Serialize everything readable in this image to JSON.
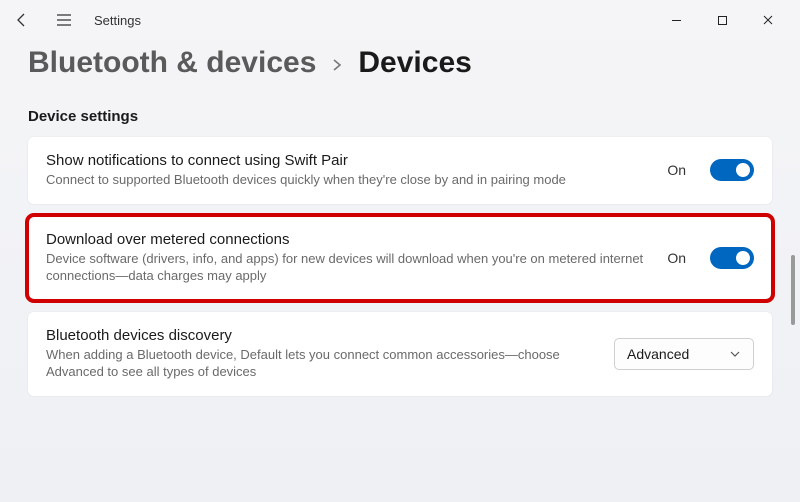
{
  "app": {
    "title": "Settings"
  },
  "breadcrumb": {
    "parent": "Bluetooth & devices",
    "current": "Devices"
  },
  "section": {
    "title": "Device settings"
  },
  "items": [
    {
      "title": "Show notifications to connect using Swift Pair",
      "desc": "Connect to supported Bluetooth devices quickly when they're close by and in pairing mode",
      "status": "On"
    },
    {
      "title": "Download over metered connections",
      "desc": "Device software (drivers, info, and apps) for new devices will download when you're on metered internet connections—data charges may apply",
      "status": "On"
    },
    {
      "title": "Bluetooth devices discovery",
      "desc": "When adding a Bluetooth device, Default lets you connect common accessories—choose Advanced to see all types of devices",
      "dropdown": "Advanced"
    }
  ]
}
